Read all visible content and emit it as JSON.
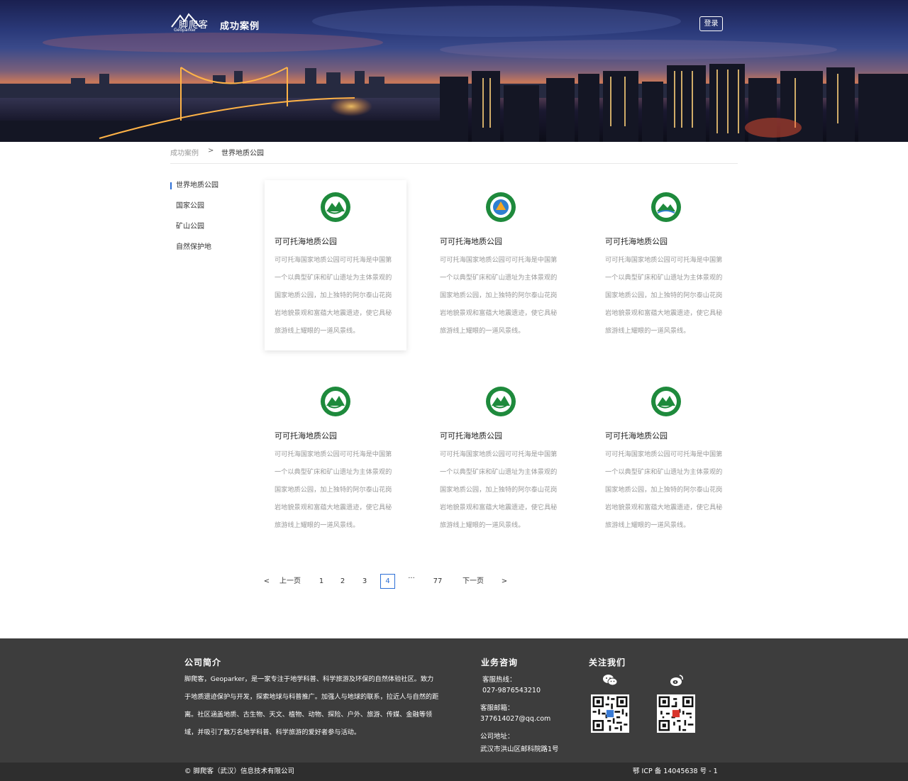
{
  "header": {
    "logo_text": "脚爬客",
    "logo_sub": "Geoparker",
    "nav_title": "成功案例",
    "login_label": "登录"
  },
  "breadcrumb": {
    "root": "成功案例",
    "separator": ">",
    "current": "世界地质公园"
  },
  "sidebar": {
    "items": [
      {
        "label": "世界地质公园",
        "active": true
      },
      {
        "label": "国家公园",
        "active": false
      },
      {
        "label": "矿山公园",
        "active": false
      },
      {
        "label": "自然保护地",
        "active": false
      }
    ]
  },
  "cards": [
    {
      "title": "可可托海地质公园",
      "desc": "可可托海国家地质公园可可托海是中国第一个以典型矿床和矿山遗址为主体景观的国家地质公园，加上独特的阿尔泰山花岗岩地貌景观和富蕴大地震遗迹，使它具秘旅游线上耀眼的一道风景线。",
      "badge_icon": "geopark-green-badge-icon"
    },
    {
      "title": "可可托海地质公园",
      "desc": "可可托海国家地质公园可可托海是中国第一个以典型矿床和矿山遗址为主体景观的国家地质公园，加上独特的阿尔泰山花岗岩地貌景观和富蕴大地震遗迹，使它具秘旅游线上耀眼的一道风景线。",
      "badge_icon": "national-park-blue-badge-icon"
    },
    {
      "title": "可可托海地质公园",
      "desc": "可可托海国家地质公园可可托海是中国第一个以典型矿床和矿山遗址为主体景观的国家地质公园，加上独特的阿尔泰山花岗岩地貌景观和富蕴大地震遗迹，使它具秘旅游线上耀眼的一道风景线。",
      "badge_icon": "mine-park-green-badge-icon"
    },
    {
      "title": "可可托海地质公园",
      "desc": "可可托海国家地质公园可可托海是中国第一个以典型矿床和矿山遗址为主体景观的国家地质公园，加上独特的阿尔泰山花岗岩地貌景观和富蕴大地震遗迹，使它具秘旅游线上耀眼的一道风景线。",
      "badge_icon": "geopark-green-badge-icon"
    },
    {
      "title": "可可托海地质公园",
      "desc": "可可托海国家地质公园可可托海是中国第一个以典型矿床和矿山遗址为主体景观的国家地质公园，加上独特的阿尔泰山花岗岩地貌景观和富蕴大地震遗迹，使它具秘旅游线上耀眼的一道风景线。",
      "badge_icon": "geopark-green-badge-icon"
    },
    {
      "title": "可可托海地质公园",
      "desc": "可可托海国家地质公园可可托海是中国第一个以典型矿床和矿山遗址为主体景观的国家地质公园，加上独特的阿尔泰山花岗岩地貌景观和富蕴大地震遗迹，使它具秘旅游线上耀眼的一道风景线。",
      "badge_icon": "geopark-green-badge-icon"
    }
  ],
  "pagination": {
    "prev_arrow": "<",
    "prev_label": "上一页",
    "pages": [
      "1",
      "2",
      "3",
      "4"
    ],
    "current_page": "4",
    "ellipsis": "···",
    "last_page": "77",
    "next_label": "下一页",
    "next_arrow": ">"
  },
  "footer": {
    "about_title": "公司简介",
    "about_text": "脚爬客，Geoparker，是一家专注于地学科普、科学旅游及环保的自然体验社区。致力于地质遗迹保护与开发，探索地球与科普推广。加强人与地球的联系，拉近人与自然的距离。社区涵盖地质、古生物、天文、植物、动物、探险、户外、旅游、传媒、金融等领域，并吸引了数万名地学科普、科学旅游的爱好者参与活动。",
    "contact_title": "业务咨询",
    "hotline_label": "客服热线：",
    "hotline_value": "027-9876543210",
    "email_label": "客服邮箱：",
    "email_value": "377614027@qq.com",
    "address_label": "公司地址：",
    "address_value": "武汉市洪山区邮科院路1号",
    "follow_title": "关注我们",
    "copyright": "© 脚爬客（武汉）信息技术有限公司",
    "icp": "鄂 ICP 备 14045638 号 - 1"
  },
  "colors": {
    "accent": "#2c6fd6",
    "footer_bg": "#3d3d3d",
    "footer_bottom_bg": "#2e2e2e",
    "badge_green": "#1e8a3c"
  }
}
